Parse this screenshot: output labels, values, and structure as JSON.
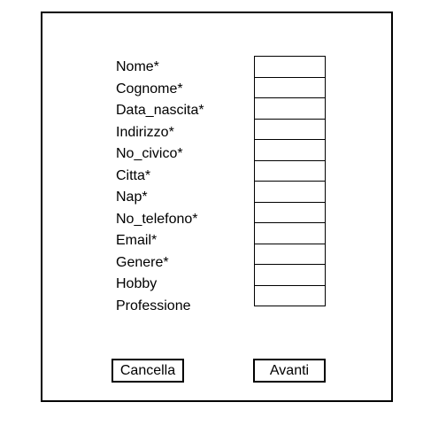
{
  "form": {
    "fields": [
      {
        "label": "Nome*",
        "value": ""
      },
      {
        "label": "Cognome*",
        "value": ""
      },
      {
        "label": "Data_nascita*",
        "value": ""
      },
      {
        "label": "Indirizzo*",
        "value": ""
      },
      {
        "label": "No_civico*",
        "value": ""
      },
      {
        "label": "Citta*",
        "value": ""
      },
      {
        "label": "Nap*",
        "value": ""
      },
      {
        "label": "No_telefono*",
        "value": ""
      },
      {
        "label": "Email*",
        "value": ""
      },
      {
        "label": "Genere*",
        "value": ""
      },
      {
        "label": "Hobby",
        "value": ""
      },
      {
        "label": "Professione",
        "value": ""
      }
    ]
  },
  "buttons": {
    "cancel_label": "Cancella",
    "next_label": "Avanti"
  },
  "colors": {
    "border": "#000000",
    "background": "#ffffff"
  }
}
